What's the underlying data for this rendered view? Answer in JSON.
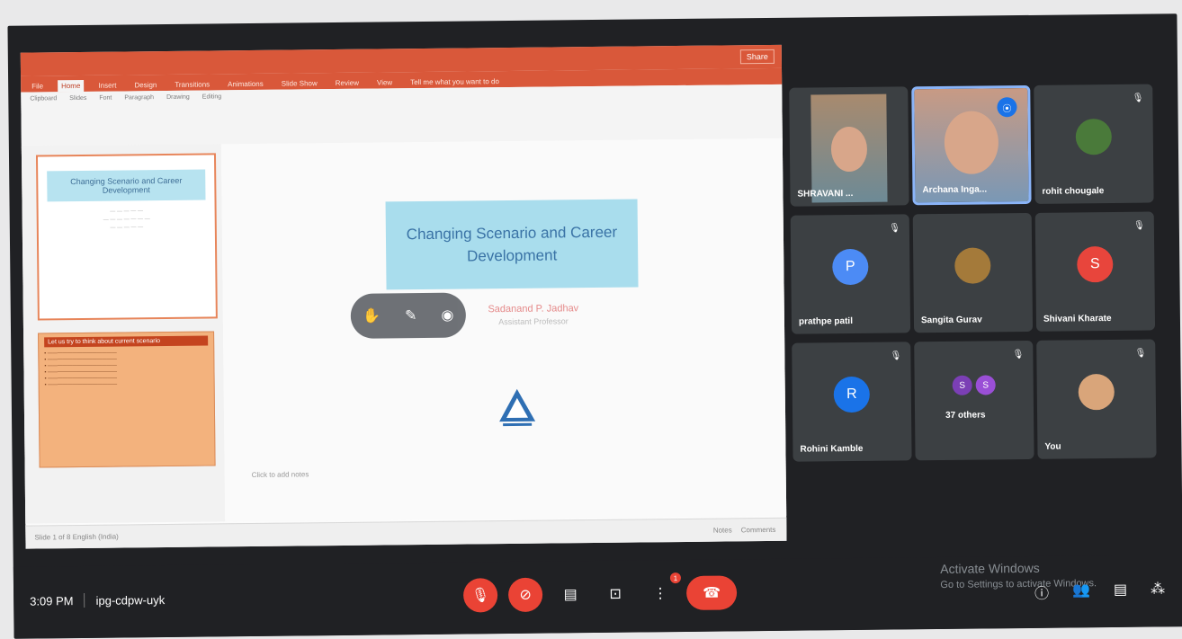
{
  "ppt": {
    "title_text": "",
    "window_button": "Share",
    "tabs": [
      "File",
      "Home",
      "Insert",
      "Design",
      "Transitions",
      "Animations",
      "Slide Show",
      "Review",
      "View",
      "Tell me what you want to do"
    ],
    "ribbon_groups": [
      "Clipboard",
      "Slides",
      "Font",
      "Paragraph",
      "Drawing",
      "Editing"
    ],
    "thumb1_title": "Changing Scenario and Career Development",
    "thumb2_title": "Let us try to think about current scenario",
    "slide_title": "Changing Scenario and Career Development",
    "presenter_name": "Sadanand P. Jadhav",
    "presenter_role": "Assistant Professor",
    "notes_text": "Click to add notes",
    "status_left": "Slide 1 of 8   English (India)",
    "status_right": [
      "Notes",
      "Comments"
    ]
  },
  "participants": [
    {
      "name": "SHRAVANI ...",
      "type": "video"
    },
    {
      "name": "Archana Inga...",
      "type": "video",
      "speaking": true
    },
    {
      "name": "rohit chougale",
      "type": "avatar-photo"
    },
    {
      "name": "prathpe patil",
      "type": "initial",
      "initial": "P",
      "color": "#4c8bf5"
    },
    {
      "name": "Sangita Gurav",
      "type": "avatar-photo"
    },
    {
      "name": "Shivani Kharate",
      "type": "initial",
      "initial": "S",
      "color": "#e8453c"
    },
    {
      "name": "Rohini Kamble",
      "type": "initial",
      "initial": "R",
      "color": "#1a73e8"
    },
    {
      "name": "37 others",
      "type": "group"
    },
    {
      "name": "You",
      "type": "avatar-photo"
    }
  ],
  "bottombar": {
    "time": "3:09 PM",
    "meeting_code": "ipg-cdpw-uyk",
    "chat_badge": "1",
    "activate_line1": "Activate Windows",
    "activate_line2": "Go to Settings to activate Windows."
  }
}
